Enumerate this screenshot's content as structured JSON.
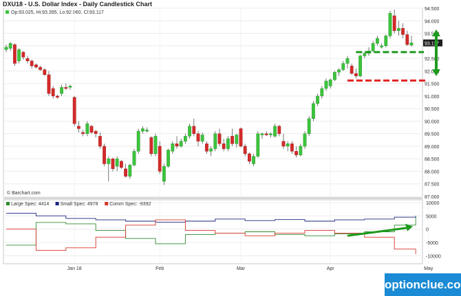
{
  "header": {
    "title": "DXU18 - U.S. Dollar Index - Daily Candlestick Chart",
    "ohlc": "Op:93.025, Hi:93.395, Lo:92.960, Cl:93.117",
    "credit": "© Barchart.com"
  },
  "watermark": "optionclue.com",
  "colors": {
    "up": "#3cc43c",
    "down": "#d42a2a",
    "large": "#2e8b2e",
    "small": "#1a237e",
    "comm": "#d9352b",
    "annotation_green": "#1e9a1e",
    "annotation_red": "#e02020",
    "price_tag": "#1c1c1c"
  },
  "chart_data": [
    {
      "type": "candlestick",
      "title": "DXU18 - U.S. Dollar Index - Daily Candlestick Chart",
      "ylim": [
        87.0,
        94.5
      ],
      "yticks": [
        94.5,
        94.0,
        93.5,
        93.0,
        92.5,
        92.0,
        91.5,
        91.0,
        90.5,
        90.0,
        89.5,
        89.0,
        88.5,
        88.0,
        87.5,
        87.0
      ],
      "ytick_labels": [
        "94.500",
        "94.000",
        "93.500",
        "",
        "92.500",
        "92.000",
        "91.500",
        "91.000",
        "90.500",
        "90.000",
        "89.500",
        "89.000",
        "88.500",
        "88.000",
        "87.500",
        "87.000"
      ],
      "x_labels": [
        {
          "label": "Jan 18",
          "idx": 16
        },
        {
          "label": "Feb",
          "idx": 36
        },
        {
          "label": "Mar",
          "idx": 55
        },
        {
          "label": "Apr",
          "idx": 76
        },
        {
          "label": "May",
          "idx": 99
        }
      ],
      "last_price_label": "93.117",
      "last_price": 93.117,
      "candles": [
        {
          "o": 92.85,
          "h": 93.05,
          "l": 92.75,
          "c": 92.95
        },
        {
          "o": 92.9,
          "h": 93.15,
          "l": 92.8,
          "c": 93.1
        },
        {
          "o": 93.05,
          "h": 93.1,
          "l": 92.2,
          "c": 92.3
        },
        {
          "o": 92.4,
          "h": 92.9,
          "l": 92.3,
          "c": 92.85
        },
        {
          "o": 92.75,
          "h": 92.8,
          "l": 92.45,
          "c": 92.55
        },
        {
          "o": 92.5,
          "h": 92.6,
          "l": 92.3,
          "c": 92.4
        },
        {
          "o": 92.4,
          "h": 92.45,
          "l": 92.1,
          "c": 92.2
        },
        {
          "o": 92.25,
          "h": 92.3,
          "l": 92.1,
          "c": 92.15
        },
        {
          "o": 92.15,
          "h": 92.2,
          "l": 92.0,
          "c": 92.05
        },
        {
          "o": 92.05,
          "h": 92.1,
          "l": 91.8,
          "c": 91.85
        },
        {
          "o": 91.85,
          "h": 92.0,
          "l": 91.0,
          "c": 91.1
        },
        {
          "o": 91.3,
          "h": 91.4,
          "l": 90.9,
          "c": 91.0
        },
        {
          "o": 91.0,
          "h": 91.05,
          "l": 90.9,
          "c": 90.95
        },
        {
          "o": 91.1,
          "h": 91.45,
          "l": 91.0,
          "c": 91.35
        },
        {
          "o": 91.35,
          "h": 91.5,
          "l": 91.25,
          "c": 91.3
        },
        {
          "o": 91.35,
          "h": 91.45,
          "l": 91.25,
          "c": 91.4
        },
        {
          "o": 90.95,
          "h": 91.0,
          "l": 89.8,
          "c": 89.9
        },
        {
          "o": 89.8,
          "h": 90.0,
          "l": 89.55,
          "c": 89.7
        },
        {
          "o": 89.55,
          "h": 89.65,
          "l": 89.4,
          "c": 89.5
        },
        {
          "o": 89.5,
          "h": 90.0,
          "l": 89.4,
          "c": 89.9
        },
        {
          "o": 89.8,
          "h": 89.85,
          "l": 89.5,
          "c": 89.55
        },
        {
          "o": 89.6,
          "h": 89.65,
          "l": 89.35,
          "c": 89.5
        },
        {
          "o": 89.4,
          "h": 89.55,
          "l": 88.9,
          "c": 89.0
        },
        {
          "o": 89.0,
          "h": 89.1,
          "l": 88.2,
          "c": 88.3
        },
        {
          "o": 88.3,
          "h": 88.6,
          "l": 87.6,
          "c": 88.5
        },
        {
          "o": 88.5,
          "h": 88.55,
          "l": 88.0,
          "c": 88.1
        },
        {
          "o": 88.2,
          "h": 88.6,
          "l": 88.0,
          "c": 88.5
        },
        {
          "o": 88.4,
          "h": 88.45,
          "l": 88.1,
          "c": 88.15
        },
        {
          "o": 88.1,
          "h": 88.3,
          "l": 87.75,
          "c": 87.8
        },
        {
          "o": 87.8,
          "h": 88.3,
          "l": 87.7,
          "c": 88.25
        },
        {
          "o": 88.25,
          "h": 88.9,
          "l": 88.2,
          "c": 88.8
        },
        {
          "o": 88.8,
          "h": 89.7,
          "l": 88.7,
          "c": 89.6
        },
        {
          "o": 89.6,
          "h": 89.8,
          "l": 89.5,
          "c": 89.7
        },
        {
          "o": 89.6,
          "h": 89.75,
          "l": 89.55,
          "c": 89.65
        },
        {
          "o": 89.35,
          "h": 89.4,
          "l": 88.6,
          "c": 88.7
        },
        {
          "o": 88.7,
          "h": 89.5,
          "l": 88.6,
          "c": 89.4
        },
        {
          "o": 89.0,
          "h": 89.2,
          "l": 87.9,
          "c": 88.0
        },
        {
          "o": 87.6,
          "h": 88.3,
          "l": 87.45,
          "c": 88.2
        },
        {
          "o": 88.2,
          "h": 88.9,
          "l": 88.15,
          "c": 88.85
        },
        {
          "o": 88.8,
          "h": 89.2,
          "l": 88.7,
          "c": 89.1
        },
        {
          "o": 89.1,
          "h": 89.4,
          "l": 88.9,
          "c": 89.0
        },
        {
          "o": 89.0,
          "h": 89.3,
          "l": 88.95,
          "c": 89.2
        },
        {
          "o": 89.2,
          "h": 89.5,
          "l": 89.1,
          "c": 89.4
        },
        {
          "o": 89.4,
          "h": 89.9,
          "l": 89.3,
          "c": 89.8
        },
        {
          "o": 89.8,
          "h": 90.1,
          "l": 89.4,
          "c": 89.5
        },
        {
          "o": 89.5,
          "h": 89.6,
          "l": 89.0,
          "c": 89.2
        },
        {
          "o": 89.2,
          "h": 89.55,
          "l": 89.1,
          "c": 89.45
        },
        {
          "o": 89.1,
          "h": 89.2,
          "l": 88.7,
          "c": 88.8
        },
        {
          "o": 88.8,
          "h": 89.0,
          "l": 88.6,
          "c": 88.9
        },
        {
          "o": 88.9,
          "h": 89.6,
          "l": 88.8,
          "c": 89.5
        },
        {
          "o": 89.5,
          "h": 89.7,
          "l": 89.0,
          "c": 89.1
        },
        {
          "o": 89.1,
          "h": 89.3,
          "l": 88.8,
          "c": 88.9
        },
        {
          "o": 88.9,
          "h": 89.4,
          "l": 88.8,
          "c": 89.3
        },
        {
          "o": 89.4,
          "h": 89.7,
          "l": 89.0,
          "c": 89.1
        },
        {
          "o": 89.1,
          "h": 89.5,
          "l": 88.95,
          "c": 89.45
        },
        {
          "o": 89.7,
          "h": 89.75,
          "l": 88.95,
          "c": 89.0
        },
        {
          "o": 89.0,
          "h": 89.1,
          "l": 88.6,
          "c": 88.7
        },
        {
          "o": 88.7,
          "h": 88.75,
          "l": 88.3,
          "c": 88.4
        },
        {
          "o": 88.3,
          "h": 88.7,
          "l": 88.2,
          "c": 88.6
        },
        {
          "o": 88.6,
          "h": 89.6,
          "l": 88.55,
          "c": 89.5
        },
        {
          "o": 89.45,
          "h": 89.55,
          "l": 89.3,
          "c": 89.5
        },
        {
          "o": 89.5,
          "h": 89.6,
          "l": 89.4,
          "c": 89.45
        },
        {
          "o": 89.45,
          "h": 89.55,
          "l": 89.35,
          "c": 89.5
        },
        {
          "o": 89.4,
          "h": 89.9,
          "l": 89.35,
          "c": 89.8
        },
        {
          "o": 89.8,
          "h": 89.85,
          "l": 89.4,
          "c": 89.5
        },
        {
          "o": 89.2,
          "h": 89.5,
          "l": 88.9,
          "c": 89.0
        },
        {
          "o": 89.0,
          "h": 89.2,
          "l": 88.8,
          "c": 89.1
        },
        {
          "o": 89.1,
          "h": 89.2,
          "l": 88.7,
          "c": 88.8
        },
        {
          "o": 88.8,
          "h": 89.0,
          "l": 88.55,
          "c": 88.65
        },
        {
          "o": 88.65,
          "h": 89.1,
          "l": 88.6,
          "c": 89.0
        },
        {
          "o": 89.0,
          "h": 89.6,
          "l": 88.9,
          "c": 89.5
        },
        {
          "o": 89.5,
          "h": 90.2,
          "l": 89.4,
          "c": 90.1
        },
        {
          "o": 90.1,
          "h": 90.8,
          "l": 90.0,
          "c": 90.7
        },
        {
          "o": 90.7,
          "h": 91.1,
          "l": 90.6,
          "c": 91.0
        },
        {
          "o": 91.0,
          "h": 91.4,
          "l": 90.9,
          "c": 91.3
        },
        {
          "o": 91.3,
          "h": 91.7,
          "l": 91.2,
          "c": 91.6
        },
        {
          "o": 91.4,
          "h": 91.7,
          "l": 91.3,
          "c": 91.65
        },
        {
          "o": 91.65,
          "h": 92.0,
          "l": 91.6,
          "c": 91.95
        },
        {
          "o": 91.95,
          "h": 92.1,
          "l": 91.8,
          "c": 92.05
        },
        {
          "o": 92.05,
          "h": 92.4,
          "l": 92.0,
          "c": 92.3
        },
        {
          "o": 92.3,
          "h": 92.6,
          "l": 92.1,
          "c": 92.5
        },
        {
          "o": 92.2,
          "h": 92.3,
          "l": 91.85,
          "c": 91.9
        },
        {
          "o": 91.9,
          "h": 92.1,
          "l": 91.7,
          "c": 91.8
        },
        {
          "o": 91.8,
          "h": 92.65,
          "l": 91.75,
          "c": 92.6
        },
        {
          "o": 92.6,
          "h": 92.75,
          "l": 92.5,
          "c": 92.7
        },
        {
          "o": 92.7,
          "h": 92.95,
          "l": 92.6,
          "c": 92.8
        },
        {
          "o": 92.8,
          "h": 93.2,
          "l": 92.75,
          "c": 93.1
        },
        {
          "o": 93.1,
          "h": 93.4,
          "l": 93.0,
          "c": 93.3
        },
        {
          "o": 92.95,
          "h": 93.1,
          "l": 92.9,
          "c": 93.0
        },
        {
          "o": 93.0,
          "h": 93.45,
          "l": 92.95,
          "c": 93.4
        },
        {
          "o": 93.4,
          "h": 94.4,
          "l": 93.3,
          "c": 94.3
        },
        {
          "o": 94.2,
          "h": 94.45,
          "l": 93.5,
          "c": 93.6
        },
        {
          "o": 93.6,
          "h": 94.0,
          "l": 93.4,
          "c": 93.7
        },
        {
          "o": 93.7,
          "h": 93.9,
          "l": 93.3,
          "c": 93.45
        },
        {
          "o": 93.45,
          "h": 93.6,
          "l": 93.0,
          "c": 93.05
        },
        {
          "o": 93.03,
          "h": 93.4,
          "l": 92.96,
          "c": 93.12
        }
      ],
      "annotations": {
        "green_level": 92.75,
        "red_level": 91.62,
        "arrow_top": 93.6,
        "arrow_bottom": 91.85
      }
    },
    {
      "type": "line",
      "title": "Commitments of Traders",
      "legend": [
        {
          "label": "Large Spec: 4414",
          "color": "#2e8b2e"
        },
        {
          "label": "Small Spec: 4978",
          "color": "#1a237e"
        },
        {
          "label": "Comm Spec: -9392",
          "color": "#d9352b"
        }
      ],
      "ylim": [
        -13000,
        11000
      ],
      "yticks": [
        10000,
        5000,
        0,
        -5000,
        -10000
      ],
      "ytick_labels": [
        "10000",
        "5000",
        "0",
        "-5000",
        "-10000"
      ],
      "n": 96,
      "series": [
        {
          "name": "Large Spec",
          "points": [
            [
              0,
              -6000
            ],
            [
              7,
              -6000
            ],
            [
              7,
              2500
            ],
            [
              14,
              2500
            ],
            [
              14,
              2000
            ],
            [
              21,
              2000
            ],
            [
              21,
              -500
            ],
            [
              28,
              -500
            ],
            [
              28,
              -3500
            ],
            [
              35,
              -3500
            ],
            [
              35,
              -5500
            ],
            [
              42,
              -5500
            ],
            [
              42,
              -2000
            ],
            [
              49,
              -2000
            ],
            [
              49,
              -1500
            ],
            [
              56,
              -1500
            ],
            [
              56,
              -1000
            ],
            [
              63,
              -1000
            ],
            [
              63,
              -2000
            ],
            [
              70,
              -2000
            ],
            [
              70,
              -2500
            ],
            [
              77,
              -2500
            ],
            [
              77,
              -1800
            ],
            [
              84,
              -1800
            ],
            [
              84,
              -1000
            ],
            [
              91,
              -1000
            ],
            [
              91,
              1500
            ],
            [
              96,
              1500
            ],
            [
              96,
              4414
            ]
          ]
        },
        {
          "name": "Small Spec",
          "points": [
            [
              0,
              6000
            ],
            [
              7,
              6000
            ],
            [
              7,
              5000
            ],
            [
              14,
              5000
            ],
            [
              14,
              4000
            ],
            [
              21,
              4000
            ],
            [
              21,
              3500
            ],
            [
              28,
              3500
            ],
            [
              28,
              3000
            ],
            [
              35,
              3000
            ],
            [
              35,
              2600
            ],
            [
              42,
              2600
            ],
            [
              42,
              3000
            ],
            [
              49,
              3000
            ],
            [
              49,
              3800
            ],
            [
              56,
              3800
            ],
            [
              56,
              3200
            ],
            [
              63,
              3200
            ],
            [
              63,
              3600
            ],
            [
              70,
              3600
            ],
            [
              70,
              3000
            ],
            [
              77,
              3000
            ],
            [
              77,
              3500
            ],
            [
              84,
              3500
            ],
            [
              84,
              3800
            ],
            [
              91,
              3800
            ],
            [
              91,
              4500
            ],
            [
              96,
              4500
            ],
            [
              96,
              4978
            ]
          ]
        },
        {
          "name": "Comm Spec",
          "points": [
            [
              0,
              0
            ],
            [
              7,
              0
            ],
            [
              7,
              -8000
            ],
            [
              14,
              -8000
            ],
            [
              14,
              -7000
            ],
            [
              21,
              -7000
            ],
            [
              21,
              -3000
            ],
            [
              28,
              -3000
            ],
            [
              28,
              1500
            ],
            [
              35,
              1500
            ],
            [
              35,
              3500
            ],
            [
              42,
              3500
            ],
            [
              42,
              -500
            ],
            [
              49,
              -500
            ],
            [
              49,
              -1500
            ],
            [
              56,
              -1500
            ],
            [
              56,
              -2500
            ],
            [
              63,
              -2500
            ],
            [
              63,
              -1500
            ],
            [
              70,
              -1500
            ],
            [
              70,
              -500
            ],
            [
              77,
              -500
            ],
            [
              77,
              -1500
            ],
            [
              84,
              -1500
            ],
            [
              84,
              -3000
            ],
            [
              91,
              -3000
            ],
            [
              91,
              -7500
            ],
            [
              96,
              -7500
            ],
            [
              96,
              -9392
            ]
          ]
        }
      ]
    }
  ]
}
